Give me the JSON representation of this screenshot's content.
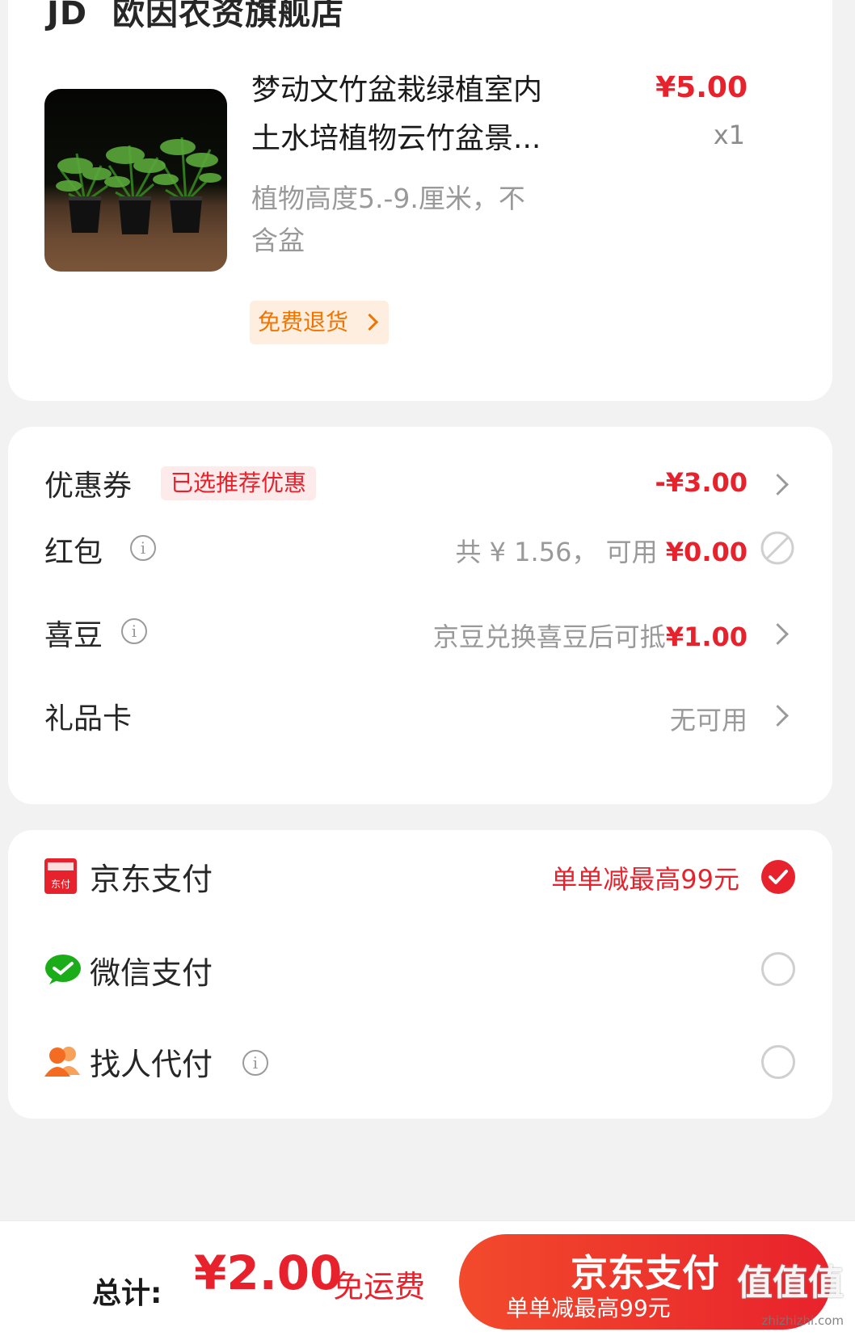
{
  "store": {
    "logo_text": "JD",
    "name": "欧因农资旗舰店"
  },
  "product": {
    "title_line1": "梦动文竹盆栽绿植室内",
    "title_line2": "土水培植物云竹盆景...",
    "price": "¥5.00",
    "quantity": "x1",
    "spec_line1": "植物高度5.-9.厘米，不",
    "spec_line2": "含盆",
    "return_tag": "免费退货"
  },
  "discounts": {
    "coupon": {
      "label": "优惠券",
      "tag": "已选推荐优惠",
      "value": "-¥3.00"
    },
    "red_packet": {
      "label": "红包",
      "total_text": "共 ¥ 1.56， 可用 ",
      "available": "¥0.00"
    },
    "xidou": {
      "label": "喜豆",
      "text": "京豆兑换喜豆后可抵",
      "amount": "¥1.00"
    },
    "gift_card": {
      "label": "礼品卡",
      "value": "无可用"
    }
  },
  "payment": {
    "methods": [
      {
        "label": "京东支付",
        "promo": "单单减最高99元",
        "icon": "jd-pay-icon",
        "icon_text": "东付",
        "selected": true
      },
      {
        "label": "微信支付",
        "icon": "wechat-pay-icon",
        "selected": false
      },
      {
        "label": "找人代付",
        "icon": "friend-pay-icon",
        "selected": false
      }
    ]
  },
  "footer": {
    "total_label": "总计:",
    "total_amount": "¥2.00",
    "shipping": "免运费",
    "pay_button": "京东支付",
    "pay_button_sub": "单单减最高99元",
    "watermark": "值值值",
    "watermark_url": "zhizhizhi.com"
  },
  "colors": {
    "accent_red": "#e8222c",
    "orange": "#f07400",
    "wechat_green": "#1aad19"
  }
}
